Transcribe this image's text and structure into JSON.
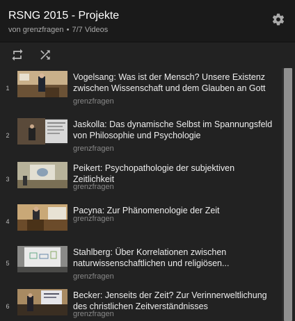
{
  "header": {
    "title": "RSNG 2015 - Projekte",
    "owner_prefix": "von grenzfragen",
    "separator": "•",
    "video_count": "7/7 Videos"
  },
  "icons": {
    "settings": "gear-icon",
    "loop": "loop-icon",
    "shuffle": "shuffle-icon"
  },
  "colors": {
    "background": "#1a1a1a",
    "list_background": "#222222",
    "title_text": "#ffffff",
    "owner_text": "#888888",
    "scrollbar": "#909090"
  },
  "videos": [
    {
      "index": "1",
      "title": "Vogelsang: Was ist der Mensch? Unsere Existenz zwischen Wissenschaft und dem Glauben an Gott",
      "owner": "grenzfragen"
    },
    {
      "index": "2",
      "title": "Jaskolla: Das dynamische Selbst im Spannungsfeld von Philosophie und Psychologie",
      "owner": "grenzfragen"
    },
    {
      "index": "3",
      "title": "Peikert: Psychopathologie der subjektiven Zeitlichkeit",
      "owner": "grenzfragen"
    },
    {
      "index": "4",
      "title": "Pacyna: Zur Phänomenologie der Zeit",
      "owner": "grenzfragen"
    },
    {
      "index": "5",
      "title": "Stahlberg: Über Korrelationen zwischen naturwissenschaftlichen und religiösen...",
      "owner": "grenzfragen"
    },
    {
      "index": "6",
      "title": "Becker: Jenseits der Zeit? Zur Verinnerweltlichung des christlichen Zeitverständnisses",
      "owner": "grenzfragen"
    }
  ]
}
